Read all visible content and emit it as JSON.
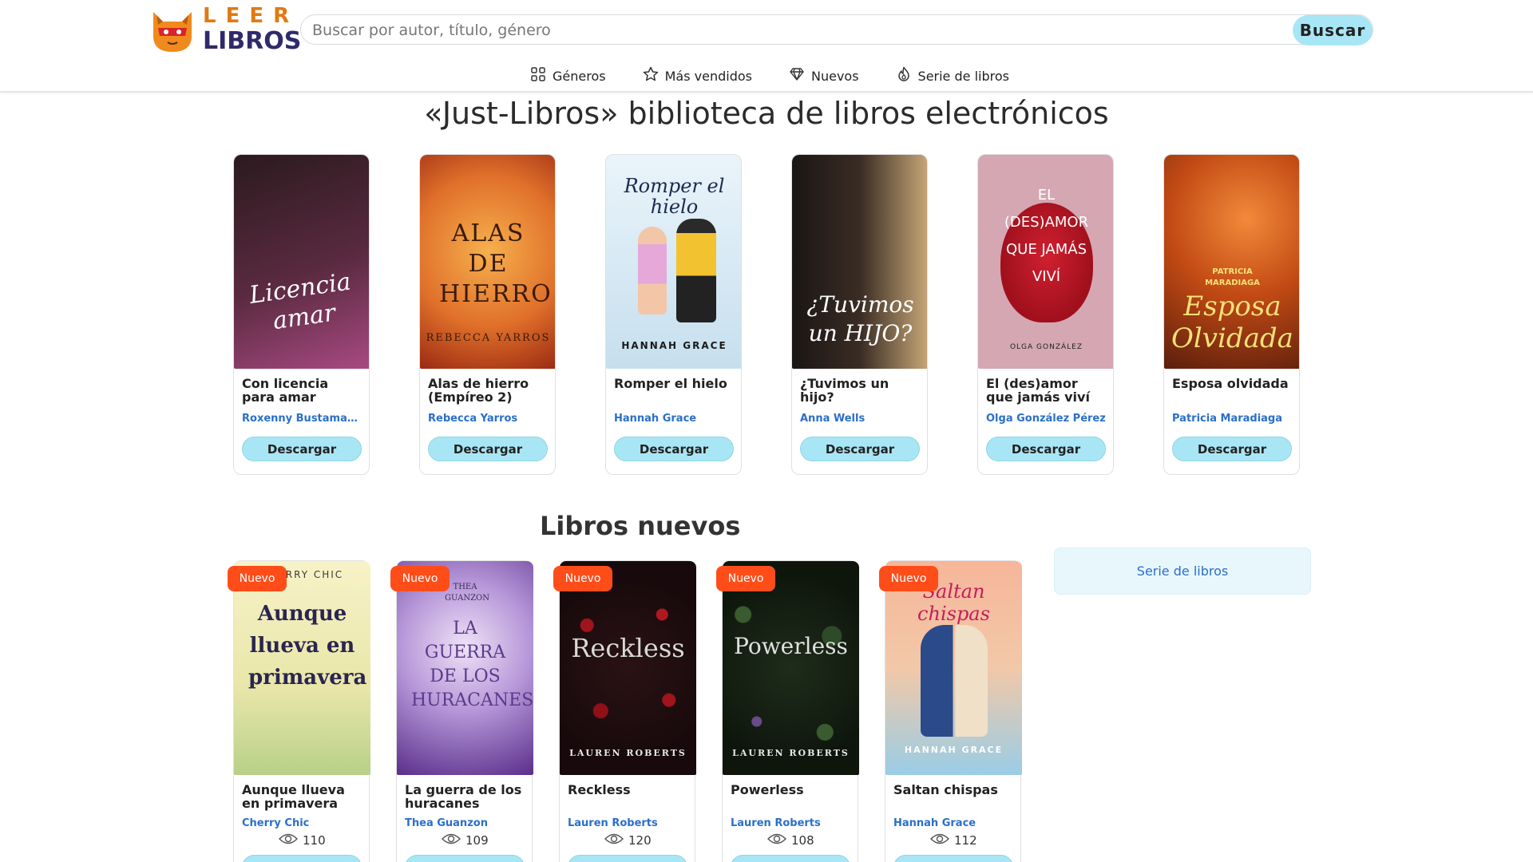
{
  "header": {
    "logo_top": "LEER",
    "logo_bottom": "LIBROS",
    "search_placeholder": "Buscar por autor, título, género",
    "search_button": "Buscar",
    "nav": [
      {
        "label": "Géneros",
        "icon": "grid-icon"
      },
      {
        "label": "Más vendidos",
        "icon": "star-icon"
      },
      {
        "label": "Nuevos",
        "icon": "diamond-icon"
      },
      {
        "label": "Serie de libros",
        "icon": "flame-icon"
      }
    ]
  },
  "main_title": "«Just-Libros» biblioteca de libros electrónicos",
  "featured": [
    {
      "title": "Con licencia para amar",
      "author": "Roxenny Bustamante",
      "button": "Descargar",
      "cover_text": "Licencia amar",
      "cover_colors": [
        "#2b1a1e",
        "#8a3a6a"
      ]
    },
    {
      "title": "Alas de hierro (Empíreo 2)",
      "author": "Rebecca Yarros",
      "button": "Descargar",
      "cover_text": "ALAS DE HIERRO",
      "cover_subtext": "REBECCA YARROS",
      "cover_colors": [
        "#f2a044",
        "#c2421c"
      ]
    },
    {
      "title": "Romper el hielo",
      "author": "Hannah Grace",
      "button": "Descargar",
      "cover_text": "Romper el hielo",
      "cover_subtext": "HANNAH GRACE",
      "cover_colors": [
        "#dfeef7",
        "#b9d7ea"
      ]
    },
    {
      "title": "¿Tuvimos un hijo?",
      "author": "Anna Wells",
      "button": "Descargar",
      "cover_text": "¿Tuvimos un HIJO?",
      "cover_colors": [
        "#1e1a18",
        "#b89a70"
      ]
    },
    {
      "title": "El (des)amor que jamás viví",
      "author": "Olga González Pérez",
      "button": "Descargar",
      "cover_text": "EL (DES)AMOR QUE JAMÁS VIVÍ",
      "cover_subtext": "OLGA GONZÁLEZ",
      "cover_colors": [
        "#d9aeb8",
        "#c4919f"
      ]
    },
    {
      "title": "Esposa olvidada",
      "author": "Patricia Maradiaga",
      "button": "Descargar",
      "cover_text": "Esposa Olvidada",
      "cover_subtext": "PATRICIA MARADIAGA",
      "cover_colors": [
        "#d8601c",
        "#5a2010"
      ]
    }
  ],
  "new_section_title": "Libros nuevos",
  "new_books": [
    {
      "badge": "Nuevo",
      "title": "Aunque llueva en primavera",
      "author": "Cherry Chic",
      "views": "110",
      "cover_text": "Aunque llueva en primavera",
      "cover_subtext": "CHERRY CHIC",
      "cover_colors": [
        "#f6f0c4",
        "#c9d98a"
      ]
    },
    {
      "badge": "Nuevo",
      "title": "La guerra de los huracanes",
      "author": "Thea Guanzon",
      "views": "109",
      "cover_text": "LA GUERRA DE LOS HURACANES",
      "cover_subtext": "THEA GUANZON",
      "cover_colors": [
        "#cdb9e6",
        "#6a3d9a"
      ]
    },
    {
      "badge": "Nuevo",
      "title": "Reckless",
      "author": "Lauren Roberts",
      "views": "120",
      "cover_text": "Reckless",
      "cover_subtext": "LAUREN ROBERTS",
      "cover_colors": [
        "#3a0f12",
        "#14090a"
      ]
    },
    {
      "badge": "Nuevo",
      "title": "Powerless",
      "author": "Lauren Roberts",
      "views": "108",
      "cover_text": "Powerless",
      "cover_subtext": "LAUREN ROBERTS",
      "cover_colors": [
        "#263a22",
        "#111a10"
      ]
    },
    {
      "badge": "Nuevo",
      "title": "Saltan chispas",
      "author": "Hannah Grace",
      "views": "112",
      "cover_text": "Saltan chispas",
      "cover_subtext": "HANNAH GRACE",
      "cover_colors": [
        "#f7b59a",
        "#8ec6e0"
      ]
    }
  ],
  "sidebar": {
    "series_label": "Serie de libros"
  },
  "colors": {
    "accent_button": "#a9e6f5",
    "badge": "#ff4d1a",
    "author_link": "#2a6fc9",
    "logo_orange": "#e07a12",
    "logo_navy": "#2f2a6b"
  }
}
